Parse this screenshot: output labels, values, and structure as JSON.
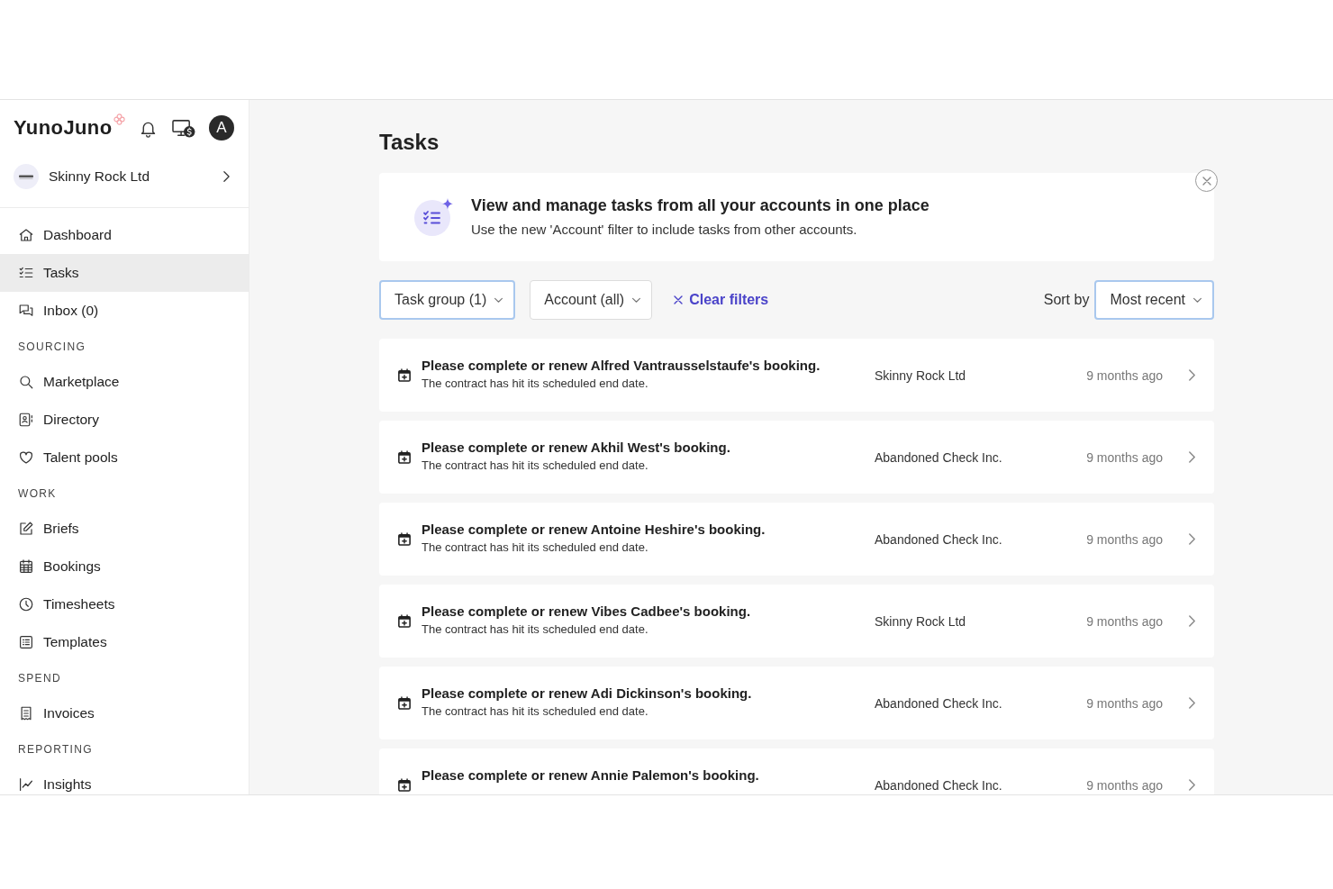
{
  "header": {
    "logo": "YunoJuno",
    "avatar": "A"
  },
  "account_switcher": {
    "name": "Skinny Rock Ltd"
  },
  "sidebar": {
    "sections": [
      {
        "items": [
          {
            "label": "Dashboard",
            "selected": false
          },
          {
            "label": "Tasks",
            "selected": true
          },
          {
            "label": "Inbox (0)",
            "selected": false
          }
        ]
      },
      {
        "heading": "SOURCING",
        "items": [
          {
            "label": "Marketplace",
            "selected": false
          },
          {
            "label": "Directory",
            "selected": false
          },
          {
            "label": "Talent pools",
            "selected": false
          }
        ]
      },
      {
        "heading": "WORK",
        "items": [
          {
            "label": "Briefs",
            "selected": false
          },
          {
            "label": "Bookings",
            "selected": false
          },
          {
            "label": "Timesheets",
            "selected": false
          },
          {
            "label": "Templates",
            "selected": false
          }
        ]
      },
      {
        "heading": "SPEND",
        "items": [
          {
            "label": "Invoices",
            "selected": false
          }
        ]
      },
      {
        "heading": "REPORTING",
        "items": [
          {
            "label": "Insights",
            "selected": false
          }
        ]
      }
    ]
  },
  "page": {
    "title": "Tasks"
  },
  "banner": {
    "title": "View and manage tasks from all your accounts in one place",
    "text": "Use the new 'Account' filter to include tasks from other accounts."
  },
  "filters": {
    "dropdowns": [
      {
        "label": "Task group (1)",
        "active": true
      },
      {
        "label": "Account (all)",
        "active": false
      }
    ],
    "clear_link": "Clear filters",
    "sort_label": "Sort by",
    "sort": {
      "value": "Most recent",
      "active": true
    }
  },
  "tasks": [
    {
      "title": "Please complete or renew Alfred Vantrausselstaufe's booking.",
      "subtitle": "The contract has hit its scheduled end date.",
      "account": "Skinny Rock Ltd",
      "time": "9 months ago"
    },
    {
      "title": "Please complete or renew Akhil West's booking.",
      "subtitle": "The contract has hit its scheduled end date.",
      "account": "Abandoned Check Inc.",
      "time": "9 months ago"
    },
    {
      "title": "Please complete or renew Antoine Heshire's booking.",
      "subtitle": "The contract has hit its scheduled end date.",
      "account": "Abandoned Check Inc.",
      "time": "9 months ago"
    },
    {
      "title": "Please complete or renew Vibes Cadbee's booking.",
      "subtitle": "The contract has hit its scheduled end date.",
      "account": "Skinny Rock Ltd",
      "time": "9 months ago"
    },
    {
      "title": "Please complete or renew Adi Dickinson's booking.",
      "subtitle": "The contract has hit its scheduled end date.",
      "account": "Abandoned Check Inc.",
      "time": "9 months ago"
    },
    {
      "title": "Please complete or renew Annie Palemon's booking.",
      "account": "Abandoned Check Inc.",
      "time": "9 months ago"
    }
  ]
}
